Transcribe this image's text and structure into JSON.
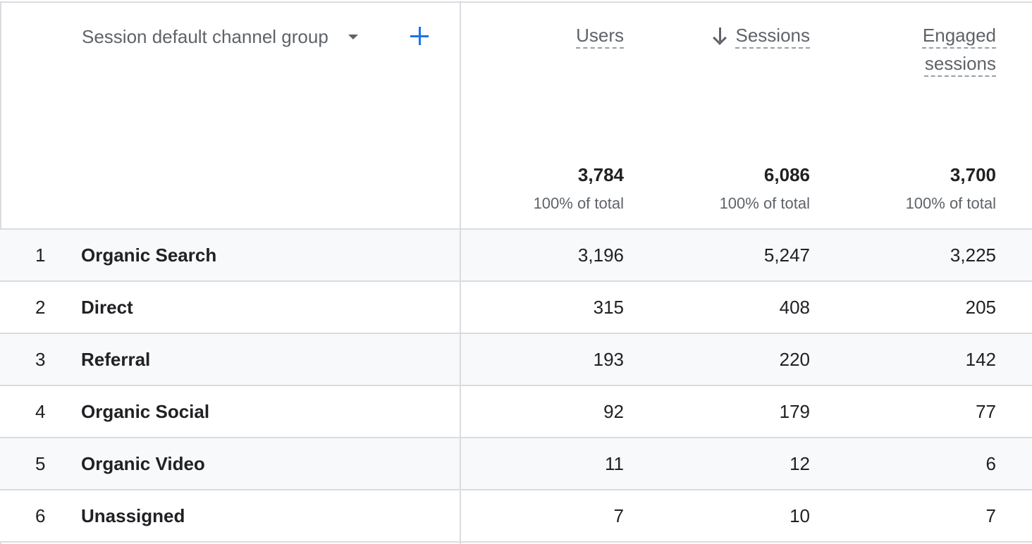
{
  "dimension": {
    "label": "Session default channel group",
    "add_icon": "plus-icon",
    "caret_icon": "caret-down-icon"
  },
  "metrics": {
    "users": {
      "label": "Users",
      "total": "3,784",
      "pct": "100% of total"
    },
    "sessions": {
      "label": "Sessions",
      "total": "6,086",
      "pct": "100% of total",
      "sort": "descending"
    },
    "engaged": {
      "label": "Engaged sessions",
      "total": "3,700",
      "pct": "100% of total"
    }
  },
  "rows": [
    {
      "rank": "1",
      "channel": "Organic Search",
      "users": "3,196",
      "sessions": "5,247",
      "engaged": "3,225"
    },
    {
      "rank": "2",
      "channel": "Direct",
      "users": "315",
      "sessions": "408",
      "engaged": "205"
    },
    {
      "rank": "3",
      "channel": "Referral",
      "users": "193",
      "sessions": "220",
      "engaged": "142"
    },
    {
      "rank": "4",
      "channel": "Organic Social",
      "users": "92",
      "sessions": "179",
      "engaged": "77"
    },
    {
      "rank": "5",
      "channel": "Organic Video",
      "users": "11",
      "sessions": "12",
      "engaged": "6"
    },
    {
      "rank": "6",
      "channel": "Unassigned",
      "users": "7",
      "sessions": "10",
      "engaged": "7"
    }
  ],
  "colors": {
    "accent": "#1a73e8",
    "border": "#dadce0",
    "alt_row": "#f8f9fa",
    "muted_text": "#5f6368"
  }
}
